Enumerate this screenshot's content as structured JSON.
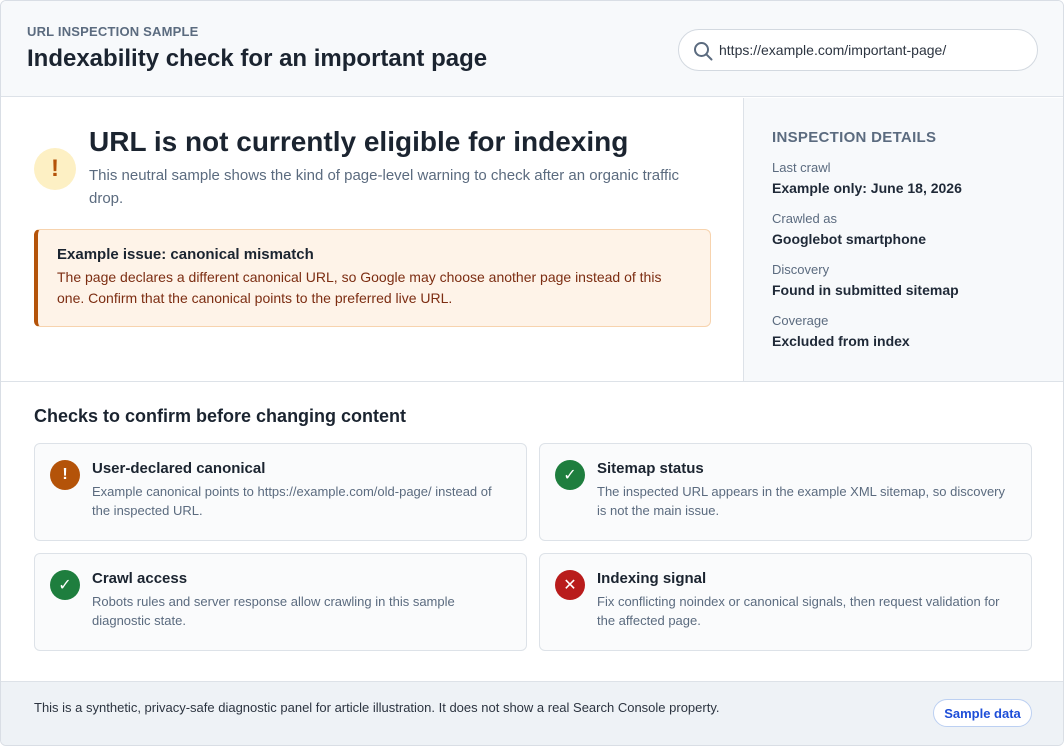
{
  "header": {
    "eyebrow": "URL INSPECTION SAMPLE",
    "title": "Indexability check for an important page",
    "search": {
      "value": "https://example.com/important-page/",
      "icon": "search-icon"
    }
  },
  "alert": {
    "icon": "warning-icon",
    "icon_glyph": "!",
    "title": "URL is not currently eligible for indexing",
    "description": "This neutral sample shows the kind of page-level warning to check after an organic traffic drop.",
    "issue": {
      "title": "Example issue: canonical mismatch",
      "text": "The page declares a different canonical URL, so Google may choose another page instead of this one. Confirm that the canonical points to the preferred live URL."
    }
  },
  "details": {
    "heading": "INSPECTION DETAILS",
    "items": [
      {
        "label": "Last crawl",
        "value": "Example only: June 18, 2026"
      },
      {
        "label": "Crawled as",
        "value": "Googlebot smartphone"
      },
      {
        "label": "Discovery",
        "value": "Found in submitted sitemap"
      },
      {
        "label": "Coverage",
        "value": "Excluded from index"
      }
    ]
  },
  "checks": {
    "heading": "Checks to confirm before changing content",
    "items": [
      {
        "status": "warning",
        "glyph": "!",
        "color": "#b45309",
        "title": "User-declared canonical",
        "text": "Example canonical points to https://example.com/old-page/ instead of the inspected URL."
      },
      {
        "status": "pass",
        "glyph": "✓",
        "color": "#1e7e3e",
        "title": "Sitemap status",
        "text": "The inspected URL appears in the example XML sitemap, so discovery is not the main issue."
      },
      {
        "status": "pass",
        "glyph": "✓",
        "color": "#1e7e3e",
        "title": "Crawl access",
        "text": "Robots rules and server response allow crawling in this sample diagnostic state."
      },
      {
        "status": "fail",
        "glyph": "✕",
        "color": "#b91c1c",
        "title": "Indexing signal",
        "text": "Fix conflicting noindex or canonical signals, then request validation for the affected page."
      }
    ]
  },
  "footer": {
    "text": "This is a synthetic, privacy-safe diagnostic panel for article illustration. It does not show a real Search Console property.",
    "badge": "Sample data"
  }
}
